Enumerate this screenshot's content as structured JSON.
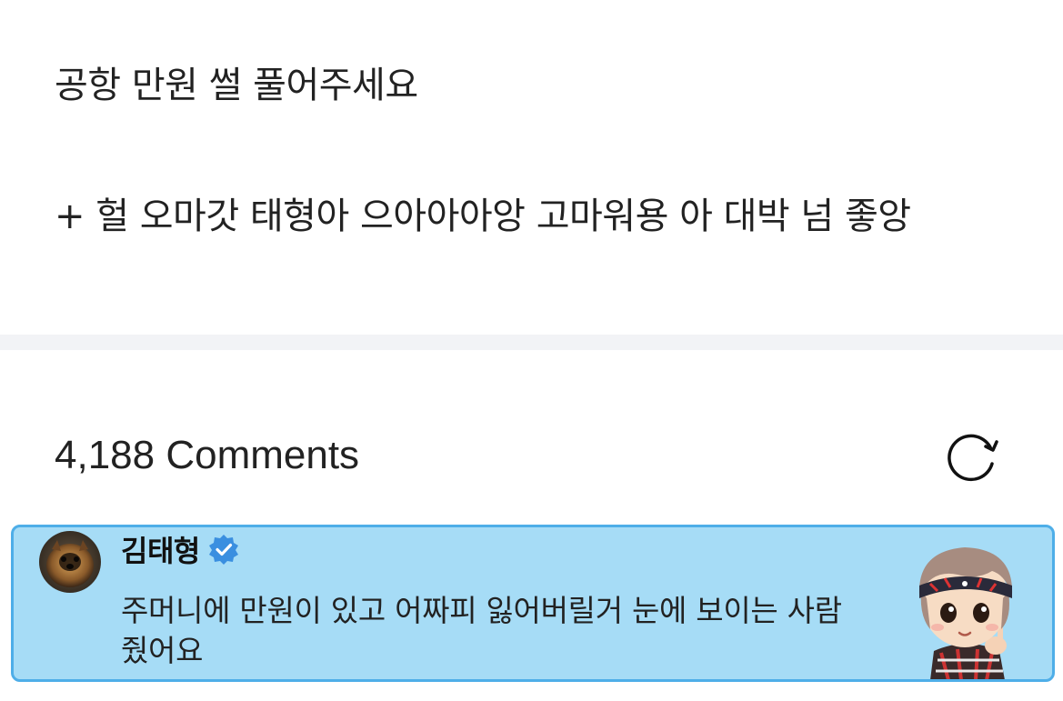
{
  "post": {
    "line1": "공항 만원 썰 풀어주세요",
    "line2": "+ 헐 오마갓 태형아 으아아아앙 고마워용 아 대박 넘 좋앙"
  },
  "comments": {
    "count_label": "4,188 Comments",
    "refresh_icon": "refresh-icon"
  },
  "highlighted_comment": {
    "author": "김태형",
    "verified_icon": "verified-badge-icon",
    "avatar": "dog-avatar",
    "text": "주머니에 만원이 있고 어짜피 잃어버릴거 눈에 보이는 사람 줬어요",
    "sticker": "character-sticker"
  },
  "colors": {
    "card_bg": "#a6dcf6",
    "card_border": "#4eaee8",
    "verified": "#3a8fe0",
    "divider": "#f2f3f6"
  }
}
